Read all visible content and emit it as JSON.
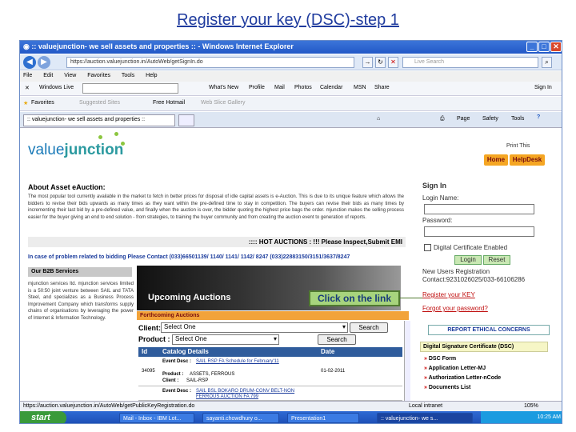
{
  "slide_title": "Register your key (DSC)-step 1",
  "window": {
    "title": ":: valuejunction- we sell assets and properties :: - Windows Internet Explorer"
  },
  "address": {
    "url": "https://auction.valuejunction.in/AutoWeb/getSignIn.do",
    "search_placeholder": "Live Search"
  },
  "menu": [
    "File",
    "Edit",
    "View",
    "Favorites",
    "Tools",
    "Help"
  ],
  "links_bar": {
    "windows_live": "Windows Live",
    "items": [
      "What's New",
      "Profile",
      "Mail",
      "Photos",
      "Calendar",
      "MSN",
      "Share"
    ],
    "sign_in": "Sign In"
  },
  "favorites_bar": {
    "favorites": "Favorites",
    "suggested": "Suggested Sites",
    "hotmail": "Free Hotmail",
    "gallery": "Web Slice Gallery"
  },
  "tab": {
    "title": ":: valuejunction- we sell assets and properties ::",
    "page": "Page",
    "safety": "Safety",
    "tools": "Tools"
  },
  "site": {
    "logo_value": "value",
    "logo_junction": "junction",
    "print_this": "Print This",
    "home": "Home",
    "helpdesk": "HelpDesk",
    "about_title": "About Asset eAuction:",
    "about_text": "The most popular tool currently available in the market to fetch in better prices for disposal of idle capital assets is e-Auction. This is due to its unique feature which allows the bidders to revise their bids upwards as many times as they want within the pre-defined time to stay in competition. The buyers can revise their bids as many times by incrementing their last bid by a pre-defined value, and finally when the auction is over, the bidder quoting the highest price bags the order. mjunction makes the selling process easier for the buyer giving an end to end solution - from strategies, to training the buyer community and from creating the auction event to generation of reports.",
    "hot_auctions": ":::: HOT AUCTIONS : !!!     Please Inspect,Submit EMI",
    "problem_line": "In case of problem related to bidding Please Contact (033)66501139/ 1140/ 1141/ 1142/ 8247 (033)22883150/3151/3637/8247",
    "b2b_header": "Our B2B Services",
    "b2b_text": "mjunction services ltd. mjunction services limited is a 50:50 joint venture between SAIL and TATA Steel, and specializes as a Business Process Improvement Company which transforms supply chains of organisations by leveraging the power of Internet & Information Technology.",
    "upcoming": "Upcoming Auctions",
    "forthcoming": "Forthcoming Auctions",
    "client_label": "Client:",
    "client_value": "Select One",
    "product_label": "Product :",
    "product_value": "Select One",
    "search": "Search",
    "table": {
      "headers": [
        "Id",
        "Catalog Details",
        "Date"
      ],
      "rows": [
        {
          "id": "34095",
          "event_label": "Event Desc :",
          "event": "SAIL RSP FA Schedule for February'11",
          "product_label": "Product :",
          "product": "ASSETS, FERROUS",
          "client_label": "Client :",
          "client": "SAIL-RSP",
          "date": "01-02-2011"
        },
        {
          "id": "",
          "event_label": "Event Desc :",
          "event": "SAIL BSL BOKARO DRUM-CONV BELT-NON FERROUS AUCTION FA 799",
          "date": ""
        }
      ]
    },
    "signin": {
      "title": "Sign In",
      "login_name": "Login Name:",
      "password": "Password:",
      "dsc_enabled": "Digital Certificate Enabled",
      "login": "Login",
      "reset": "Reset",
      "new_users": "New Users Registration",
      "contact": "Contact:9231026025/033-66106286",
      "register_key": "Register your KEY",
      "forgot": "Forgot your password?",
      "ethical": "REPORT ETHICAL CONCERNS"
    },
    "dsc": {
      "header": "Digital Signature Certificate (DSC)",
      "items": [
        "DSC Form",
        "Application Letter-MJ",
        "Authorization Letter-nCode",
        "Documents List"
      ]
    }
  },
  "callout": "Click on the link",
  "status": {
    "url": "https://auction.valuejunction.in/AutoWeb/getPublicKeyRegistration.do",
    "zone": "Local intranet",
    "zoom": "105%"
  },
  "taskbar": {
    "start": "start",
    "tasks": [
      "Mail - Inbox - IBM Lot...",
      "sayanti.chowdhury o...",
      "Presentation1",
      ":: valuejunction- we s..."
    ],
    "time": "10:25 AM"
  }
}
